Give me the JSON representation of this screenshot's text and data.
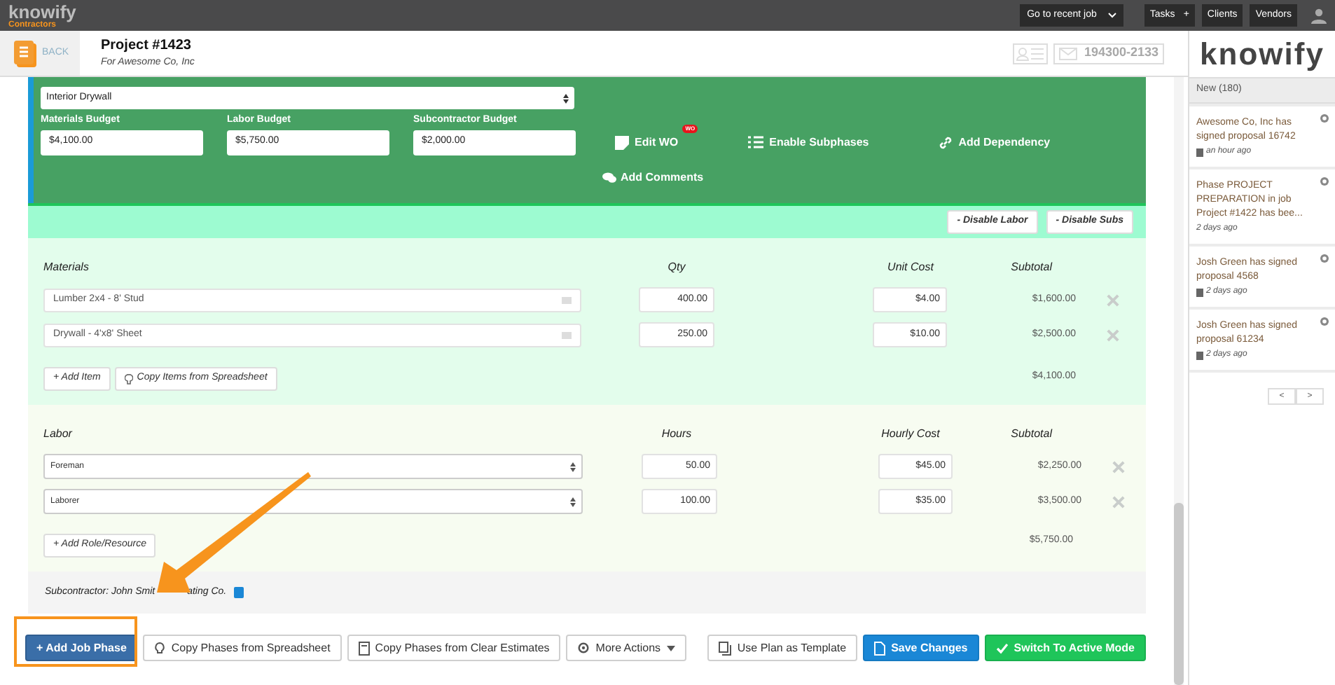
{
  "topbar": {
    "logo": "knowify",
    "logo_sub": "Contractors",
    "recent_job": "Go to recent job",
    "buttons": [
      {
        "label": "Tasks",
        "suffix": "+"
      },
      {
        "label": "Clients"
      },
      {
        "label": "Vendors"
      }
    ]
  },
  "header": {
    "back": "BACK",
    "title": "Project #1423",
    "subtitle": "For Awesome Co, Inc",
    "phone": "194300-2133"
  },
  "phase": {
    "deliverable": "Interior Drywall",
    "budgets": [
      {
        "label": "Materials Budget",
        "value": "$4,100.00"
      },
      {
        "label": "Labor Budget",
        "value": "$5,750.00"
      },
      {
        "label": "Subcontractor Budget",
        "value": "$2,000.00"
      }
    ],
    "actions": [
      {
        "kind": "edit",
        "label": "Edit WO",
        "badge": "WO"
      },
      {
        "kind": "list",
        "label": "Enable Subphases"
      },
      {
        "kind": "link",
        "label": "Add Dependency"
      }
    ],
    "comments": "Add Comments"
  },
  "toggles": [
    "- Disable Labor",
    "- Disable Subs"
  ],
  "materials": {
    "heading": "Materials",
    "columns": [
      "Qty",
      "Unit Cost",
      "Subtotal"
    ],
    "rows": [
      {
        "name": "Lumber 2x4 - 8' Stud",
        "qty": "400.00",
        "cost": "$4.00",
        "subtotal": "$1,600.00"
      },
      {
        "name": "Drywall - 4'x8' Sheet",
        "qty": "250.00",
        "cost": "$10.00",
        "subtotal": "$2,500.00"
      }
    ],
    "buttons": [
      "+ Add Item",
      "Copy Items from Spreadsheet"
    ],
    "total": "$4,100.00"
  },
  "labor": {
    "heading": "Labor",
    "columns": [
      "Hours",
      "Hourly Cost",
      "Subtotal"
    ],
    "rows": [
      {
        "name": "Foreman",
        "qty": "50.00",
        "cost": "$45.00",
        "subtotal": "$2,250.00"
      },
      {
        "name": "Laborer",
        "qty": "100.00",
        "cost": "$35.00",
        "subtotal": "$3,500.00"
      }
    ],
    "buttons": [
      "+ Add Role/Resource"
    ],
    "total": "$5,750.00"
  },
  "subcontractor": {
    "text_start": "Subcontractor: John Smit",
    "text_end": "ating Co."
  },
  "footer": {
    "left": [
      {
        "kind": "primary",
        "label": "+ Add Job Phase"
      },
      {
        "kind": "spreadsheet",
        "label": "Copy Phases from Spreadsheet"
      },
      {
        "kind": "estimate",
        "label": "Copy Phases from Clear Estimates"
      },
      {
        "kind": "more",
        "label": "More Actions"
      }
    ],
    "right": [
      {
        "kind": "template",
        "label": "Use Plan as Template"
      },
      {
        "kind": "save",
        "label": "Save Changes"
      },
      {
        "kind": "active",
        "label": "Switch To Active Mode"
      }
    ]
  },
  "sidebar": {
    "logo": "knowify",
    "new": "New (180)",
    "notifications": [
      {
        "text": "Awesome Co, Inc has signed proposal 16742",
        "time": "an hour ago",
        "doc_icon": true
      },
      {
        "text": "Phase PROJECT PREPARATION in job Project #1422 has bee...",
        "time": "2 days ago",
        "doc_icon": false
      },
      {
        "text": "Josh Green has signed proposal 4568",
        "time": "2 days ago",
        "doc_icon": true
      },
      {
        "text": "Josh Green has signed proposal 61234",
        "time": "2 days ago",
        "doc_icon": true
      }
    ],
    "pager": [
      "<",
      ">"
    ]
  }
}
